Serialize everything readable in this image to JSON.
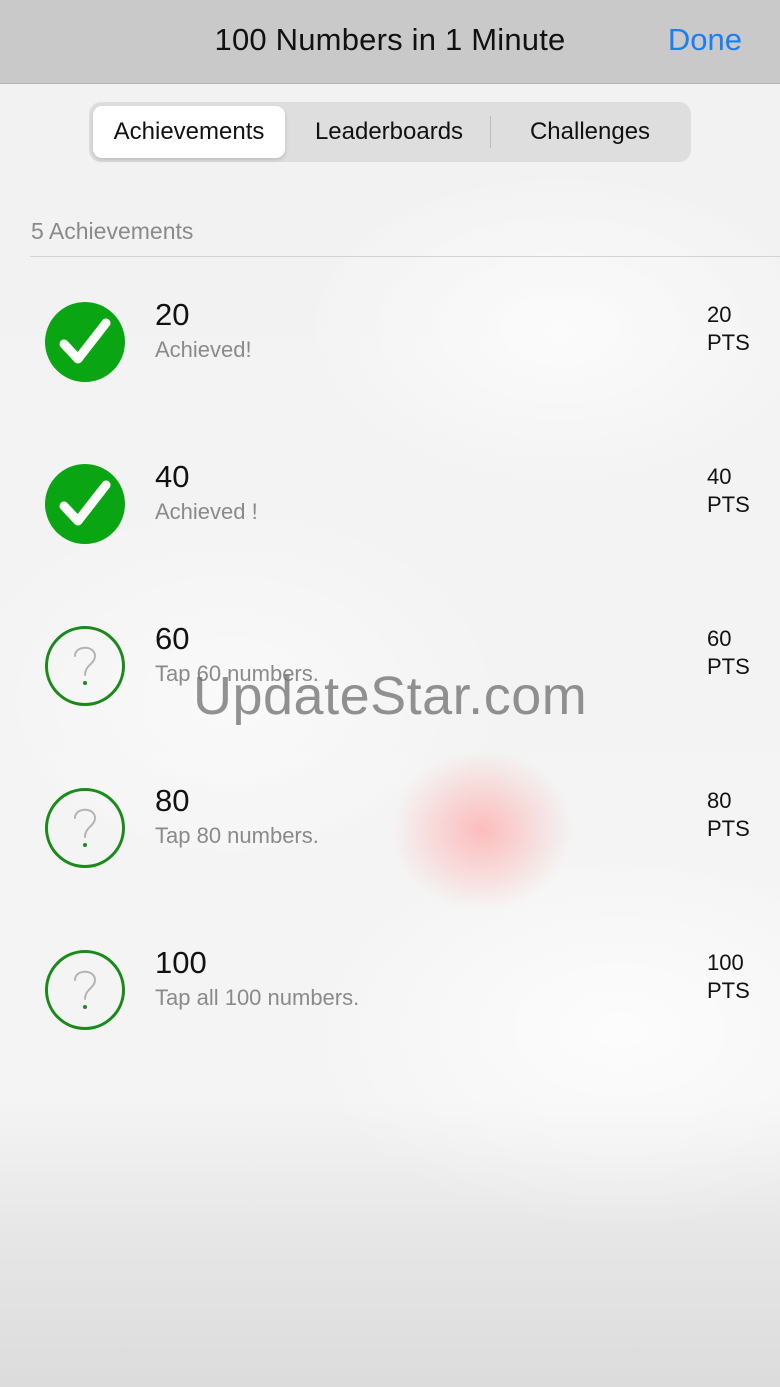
{
  "nav": {
    "title": "100 Numbers in 1 Minute",
    "done_label": "Done"
  },
  "tabs": [
    {
      "label": "Achievements",
      "selected": true
    },
    {
      "label": "Leaderboards",
      "selected": false
    },
    {
      "label": "Challenges",
      "selected": false
    }
  ],
  "section": {
    "header": "5 Achievements"
  },
  "achievements": [
    {
      "title": "20",
      "subtitle": "Achieved!",
      "points": "20",
      "points_unit": "PTS",
      "status": "achieved",
      "icon": "checkmark-icon"
    },
    {
      "title": "40",
      "subtitle": "Achieved !",
      "points": "40",
      "points_unit": "PTS",
      "status": "achieved",
      "icon": "checkmark-icon"
    },
    {
      "title": "60",
      "subtitle": "Tap 60 numbers.",
      "points": "60",
      "points_unit": "PTS",
      "status": "locked",
      "icon": "question-mark-icon"
    },
    {
      "title": "80",
      "subtitle": "Tap 80 numbers.",
      "points": "80",
      "points_unit": "PTS",
      "status": "locked",
      "icon": "question-mark-icon"
    },
    {
      "title": "100",
      "subtitle": "Tap all 100 numbers.",
      "points": "100",
      "points_unit": "PTS",
      "status": "locked",
      "icon": "question-mark-icon"
    }
  ],
  "watermark": "UpdateStar.com",
  "colors": {
    "accent": "#1a7ef5",
    "achieved_green": "#0aa512",
    "locked_green": "#1a8a1a"
  }
}
